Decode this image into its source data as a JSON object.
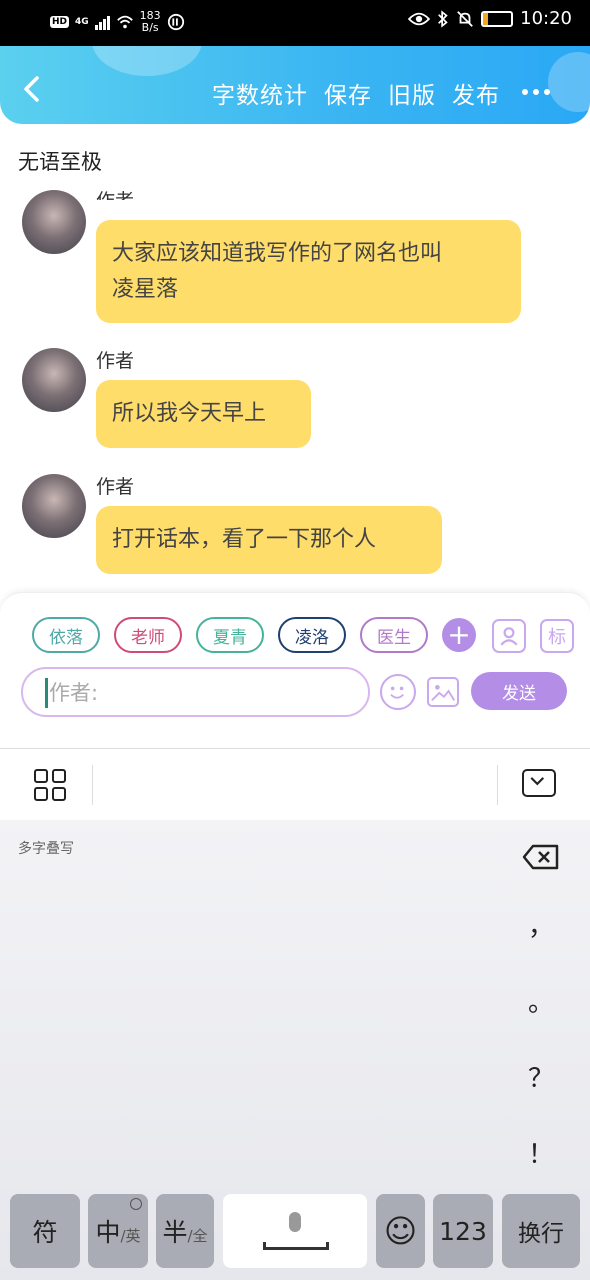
{
  "status_bar": {
    "network_badge": "HD",
    "network_type": "4G",
    "speed_value": "183",
    "speed_unit": "B/s",
    "battery": "17",
    "time": "10:20"
  },
  "header": {
    "actions": [
      "字数统计",
      "保存",
      "旧版",
      "发布"
    ],
    "accent_color": "#39b4f2"
  },
  "document": {
    "title": "无语至极"
  },
  "messages": [
    {
      "author": "作者",
      "text_lines": [
        "大家应该知道我写作的了网名也叫",
        "凌星落"
      ]
    },
    {
      "author": "作者",
      "text_lines": [
        "所以我今天早上"
      ]
    },
    {
      "author": "作者",
      "text_lines": [
        "打开话本，看了一下那个人"
      ]
    }
  ],
  "composer": {
    "characters": [
      {
        "name": "依落",
        "color": "#4fa9a6"
      },
      {
        "name": "老师",
        "color": "#d04a7a"
      },
      {
        "name": "夏青",
        "color": "#44b39a"
      },
      {
        "name": "凌洛",
        "color": "#1f3f6e"
      },
      {
        "name": "医生",
        "color": "#b07ac8"
      }
    ],
    "add_symbol": "+",
    "mark_button": "标",
    "input_placeholder": "作者:",
    "send_label": "发送",
    "accent_color": "#b48ee6"
  },
  "keyboard": {
    "hint": "多字叠写",
    "punctuation": [
      "，",
      "。",
      "？",
      "！"
    ],
    "keys": {
      "symbols": "符",
      "lang_main": "中",
      "lang_alt": "/英",
      "width_main": "半",
      "width_alt": "/全",
      "emoji": "☺",
      "numbers": "123",
      "enter": "换行"
    }
  }
}
